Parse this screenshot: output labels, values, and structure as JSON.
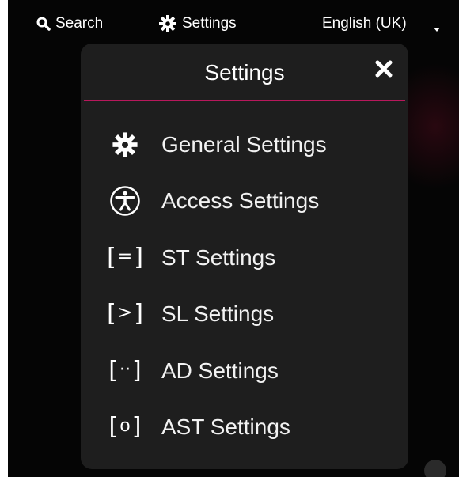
{
  "topbar": {
    "search": {
      "label": "Search",
      "icon": "search-icon"
    },
    "settings": {
      "label": "Settings",
      "icon": "gear-icon"
    },
    "language": {
      "label": "English (UK)",
      "icon": "caret-down-icon"
    }
  },
  "panel": {
    "title": "Settings",
    "close_icon": "close-icon",
    "accent_color": "#b8185c",
    "items": [
      {
        "label": "General Settings",
        "icon": "gear-icon"
      },
      {
        "label": "Access Settings",
        "icon": "accessibility-icon"
      },
      {
        "label": "ST Settings",
        "icon": "st-bracket-icon",
        "glyph": "="
      },
      {
        "label": "SL Settings",
        "icon": "sl-bracket-icon",
        "glyph": ">"
      },
      {
        "label": "AD Settings",
        "icon": "ad-bracket-icon",
        "glyph": "··"
      },
      {
        "label": "AST Settings",
        "icon": "ast-bracket-icon",
        "glyph": "o"
      }
    ]
  }
}
